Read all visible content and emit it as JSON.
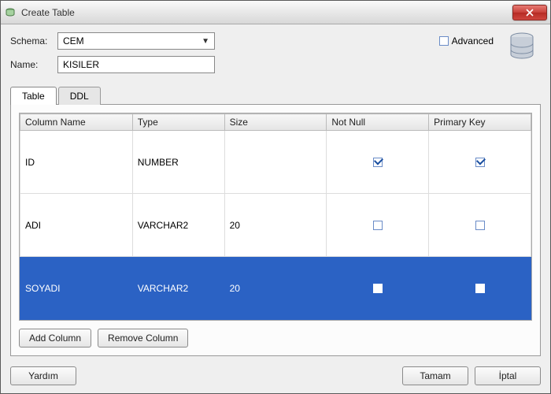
{
  "window": {
    "title": "Create Table"
  },
  "form": {
    "schema_label": "Schema:",
    "schema_value": "CEM",
    "name_label": "Name:",
    "name_value": "KISILER"
  },
  "advanced": {
    "label": "Advanced",
    "checked": false
  },
  "tabs": {
    "table": "Table",
    "ddl": "DDL",
    "active": "table"
  },
  "columns": {
    "headers": {
      "name": "Column Name",
      "type": "Type",
      "size": "Size",
      "notnull": "Not Null",
      "pk": "Primary Key"
    },
    "rows": [
      {
        "name": "ID",
        "type": "NUMBER",
        "size": "",
        "notnull": true,
        "pk": true,
        "selected": false
      },
      {
        "name": "ADI",
        "type": "VARCHAR2",
        "size": "20",
        "notnull": false,
        "pk": false,
        "selected": false
      },
      {
        "name": "SOYADI",
        "type": "VARCHAR2",
        "size": "20",
        "notnull": false,
        "pk": false,
        "selected": true
      }
    ]
  },
  "buttons": {
    "add_column": "Add Column",
    "remove_column": "Remove Column",
    "help": "Yardım",
    "ok": "Tamam",
    "cancel": "İptal"
  }
}
